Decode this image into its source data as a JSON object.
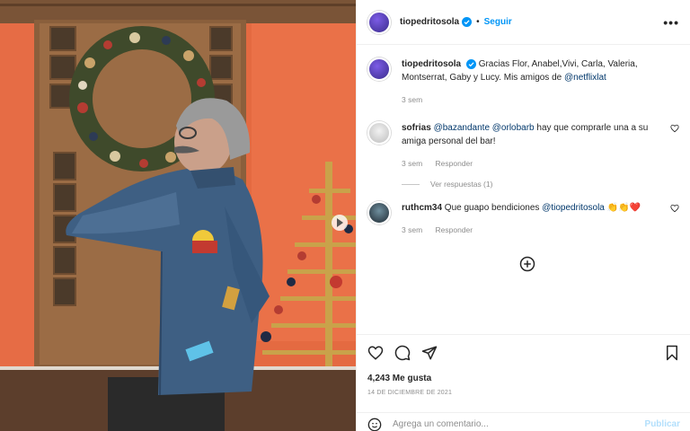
{
  "post": {
    "username": "tiopedritosola",
    "follow_label": "Seguir",
    "more_label": "•••",
    "caption_prefix": "Gracias Flor, Anabel,Vivi, Carla, Valeria, Montserrat, Gaby y Lucy. Mis amigos de ",
    "caption_mention": "@netflixlat",
    "caption_time": "3 sem",
    "likes": "4,243 Me gusta",
    "date": "14 DE DICIEMBRE DE 2021",
    "comment_placeholder": "Agrega un comentario...",
    "publish_label": "Publicar"
  },
  "comments": [
    {
      "username": "sofrias",
      "mention1": "@bazandante",
      "mention2": "@orlobarb",
      "text": " hay que comprarle una a su amiga personal del bar!",
      "time": "3 sem",
      "reply_label": "Responder",
      "view_replies": "Ver respuestas (1)"
    },
    {
      "username": "ruthcm34",
      "text": " Que guapo bendiciones ",
      "mention": "@tiopedritosola",
      "emoji": " 👏👏❤️",
      "time": "3 sem",
      "reply_label": "Responder"
    }
  ],
  "colors": {
    "accent": "#0095f6",
    "mention": "#00376b",
    "secondary_text": "#8e8e8e",
    "wall_orange": "#e9683f"
  },
  "icons": [
    "verified-badge-icon",
    "heart-icon",
    "comment-icon",
    "share-icon",
    "bookmark-icon",
    "emoji-icon",
    "add-circle-icon"
  ]
}
